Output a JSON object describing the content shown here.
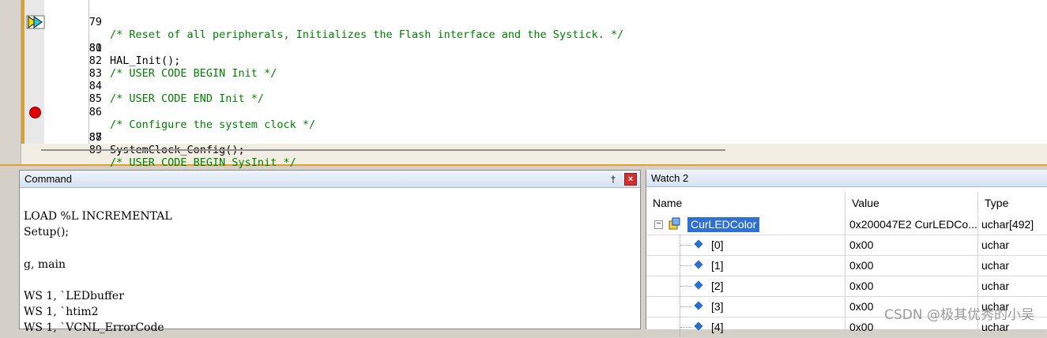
{
  "editor": {
    "lines": [
      {
        "num": "79",
        "text": "/* Reset of all peripherals, Initializes the Flash interface and the Systick. */",
        "comment": true
      },
      {
        "num": "80",
        "text": "HAL_Init();",
        "comment": false
      },
      {
        "num": "81",
        "text": "",
        "comment": false
      },
      {
        "num": "82",
        "text": "/* USER CODE BEGIN Init */",
        "comment": true
      },
      {
        "num": "83",
        "text": "",
        "comment": false
      },
      {
        "num": "84",
        "text": "/* USER CODE END Init */",
        "comment": true
      },
      {
        "num": "85",
        "text": "",
        "comment": false
      },
      {
        "num": "86",
        "text": "/* Configure the system clock */",
        "comment": true
      },
      {
        "num": "87",
        "text": "SystemClock_Config();",
        "comment": false
      },
      {
        "num": "88",
        "text": "",
        "comment": false
      },
      {
        "num": "89",
        "text": "/* USER CODE BEGIN SysInit */",
        "comment": true
      }
    ],
    "current_line": "80",
    "breakpoint_line": "87"
  },
  "command": {
    "title": "Command",
    "pin_glyph": "†",
    "close_glyph": "×",
    "lines": [
      "LOAD %L INCREMENTAL",
      "Setup();",
      "",
      "g, main",
      "",
      "WS 1, `LEDbuffer",
      "WS 1, `htim2",
      "WS 1, `VCNL_ErrorCode"
    ]
  },
  "watch": {
    "title": "Watch 2",
    "columns": [
      "Name",
      "Value",
      "Type"
    ],
    "rows": [
      {
        "name": "CurLEDColor",
        "value": "0x200047E2 CurLEDCo...",
        "type": "uchar[492]",
        "level": 0,
        "selected": true,
        "expander": "−"
      },
      {
        "name": "[0]",
        "value": "0x00",
        "type": "uchar",
        "level": 1
      },
      {
        "name": "[1]",
        "value": "0x00",
        "type": "uchar",
        "level": 1
      },
      {
        "name": "[2]",
        "value": "0x00",
        "type": "uchar",
        "level": 1
      },
      {
        "name": "[3]",
        "value": "0x00",
        "type": "uchar",
        "level": 1
      },
      {
        "name": "[4]",
        "value": "0x00",
        "type": "uchar",
        "level": 1
      }
    ]
  },
  "watermark": "CSDN @极其优秀的小吴",
  "colors": {
    "comment": "#008000",
    "selection": "#3070d0",
    "breakpoint": "#e00000",
    "accent": "#e0a030"
  }
}
